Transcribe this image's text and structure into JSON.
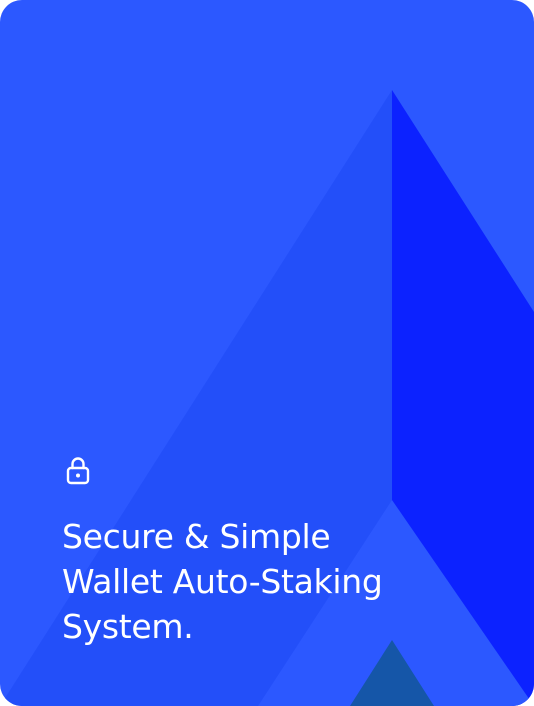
{
  "card": {
    "background_color": "#2c58ff",
    "lock_icon": "lock-icon",
    "headline": {
      "line1": "Secure & Simple",
      "line2": "Wallet Auto-Staking",
      "line3": "System."
    }
  }
}
